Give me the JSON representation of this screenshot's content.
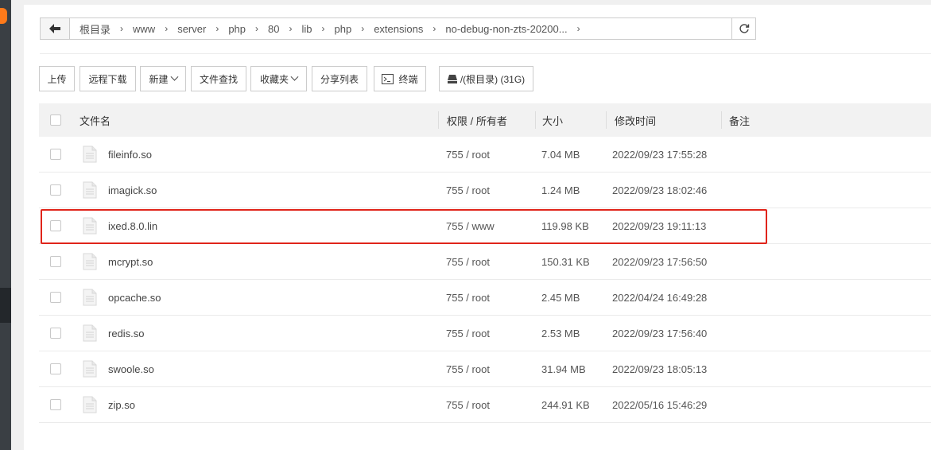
{
  "path": {
    "crumbs": [
      "根目录",
      "www",
      "server",
      "php",
      "80",
      "lib",
      "php",
      "extensions",
      "no-debug-non-zts-20200..."
    ]
  },
  "toolbar": {
    "upload": "上传",
    "remote_download": "远程下载",
    "new": "新建",
    "file_search": "文件查找",
    "favorites": "收藏夹",
    "share_list": "分享列表",
    "terminal": "终端",
    "disk": "/(根目录) (31G)"
  },
  "table": {
    "headers": {
      "name": "文件名",
      "perm_owner": "权限 / 所有者",
      "size": "大小",
      "mtime": "修改时间",
      "note": "备注"
    },
    "rows": [
      {
        "name": "fileinfo.so",
        "perm": "755 / root",
        "size": "7.04 MB",
        "mtime": "2022/09/23 17:55:28"
      },
      {
        "name": "imagick.so",
        "perm": "755 / root",
        "size": "1.24 MB",
        "mtime": "2022/09/23 18:02:46"
      },
      {
        "name": "ixed.8.0.lin",
        "perm": "755 / www",
        "size": "119.98 KB",
        "mtime": "2022/09/23 19:11:13"
      },
      {
        "name": "mcrypt.so",
        "perm": "755 / root",
        "size": "150.31 KB",
        "mtime": "2022/09/23 17:56:50"
      },
      {
        "name": "opcache.so",
        "perm": "755 / root",
        "size": "2.45 MB",
        "mtime": "2022/04/24 16:49:28"
      },
      {
        "name": "redis.so",
        "perm": "755 / root",
        "size": "2.53 MB",
        "mtime": "2022/09/23 17:56:40"
      },
      {
        "name": "swoole.so",
        "perm": "755 / root",
        "size": "31.94 MB",
        "mtime": "2022/09/23 18:05:13"
      },
      {
        "name": "zip.so",
        "perm": "755 / root",
        "size": "244.91 KB",
        "mtime": "2022/05/16 15:46:29"
      }
    ]
  },
  "colors": {
    "highlight": "#e0241a",
    "accent_badge": "#ff7a1a",
    "sidebar": "#3a3f44"
  }
}
